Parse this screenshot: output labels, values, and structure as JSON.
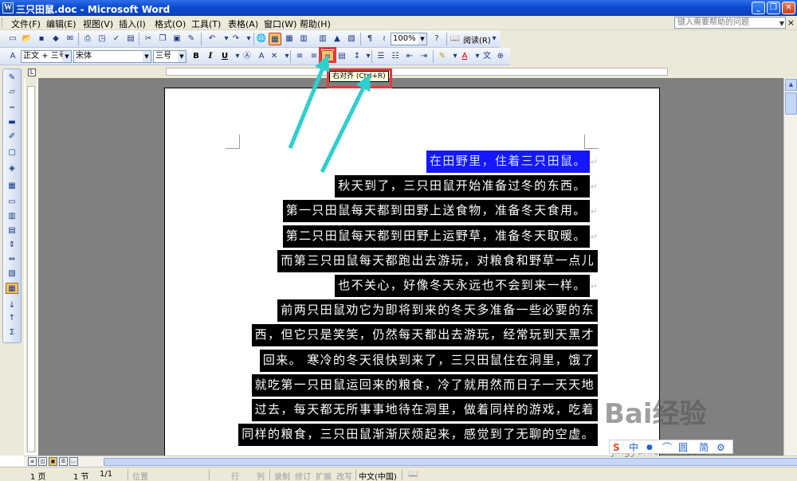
{
  "window": {
    "title": "三只田鼠.doc - Microsoft Word",
    "minimize_label": "_",
    "restore_label": "❐",
    "close_label": "✕"
  },
  "menu": {
    "items": [
      "文件(F)",
      "编辑(E)",
      "视图(V)",
      "插入(I)",
      "格式(O)",
      "工具(T)",
      "表格(A)",
      "窗口(W)",
      "帮助(H)"
    ],
    "help_placeholder": "键入需要帮助的问题",
    "doc_close": "×"
  },
  "toolbar_standard": {
    "zoom": "100%",
    "read_label": "阅读(R)"
  },
  "toolbar_format": {
    "style": "正文 + 三号",
    "font": "宋体",
    "size": "三号",
    "bold": "B",
    "italic": "I",
    "underline": "U",
    "active_button": "align-right"
  },
  "tooltip": {
    "text": "右对齐 (Ctrl+R)"
  },
  "document": {
    "paragraph_mark": "↵",
    "lines": [
      {
        "text": "在田野里，住着三只田鼠。",
        "selected_blue": true
      },
      {
        "text": "秋天到了，三只田鼠开始准备过冬的东西。"
      },
      {
        "text": "第一只田鼠每天都到田野上送食物，准备冬天食用。"
      },
      {
        "text": "第二只田鼠每天都到田野上运野草，准备冬天取暖。"
      },
      {
        "text": "而第三只田鼠每天都跑出去游玩，对粮食和野草一点儿"
      },
      {
        "text": "也不关心，好像冬天永远也不会到来一样。"
      },
      {
        "text": "前两只田鼠劝它为即将到来的冬天多准备一些必要的东"
      },
      {
        "text": "西，但它只是笑笑，仍然每天都出去游玩，经常玩到天黑才"
      },
      {
        "text": "回来。 寒冷的冬天很快到来了，三只田鼠住在洞里，饿了"
      },
      {
        "text": "就吃第一只田鼠运回来的粮食，冷了就用然而日子一天天地"
      },
      {
        "text": "过去，每天都无所事事地待在洞里，做着同样的游戏，吃着"
      },
      {
        "text": "同样的粮食，三只田鼠渐渐厌烦起来，感觉到了无聊的空虚。"
      }
    ]
  },
  "statusbar": {
    "page": "1 页",
    "section": "1 节",
    "page_of": "1/1",
    "position": "位置",
    "line": "行",
    "column": "列",
    "rec": "录制",
    "trk": "修订",
    "ext": "扩展",
    "ovr": "改写",
    "language": "中文(中国)"
  },
  "watermark": {
    "logo": "Bai经验",
    "url": "jingyan.baidu.com"
  },
  "ime": {
    "items": [
      "S",
      "中",
      "●",
      "⌒",
      "圆",
      "简",
      "⚙"
    ]
  },
  "colors": {
    "selection_black": "#000000",
    "selection_blue": "#1717ff",
    "annotation_red": "#e23b3b",
    "arrow_cyan": "#2ecfcf"
  }
}
